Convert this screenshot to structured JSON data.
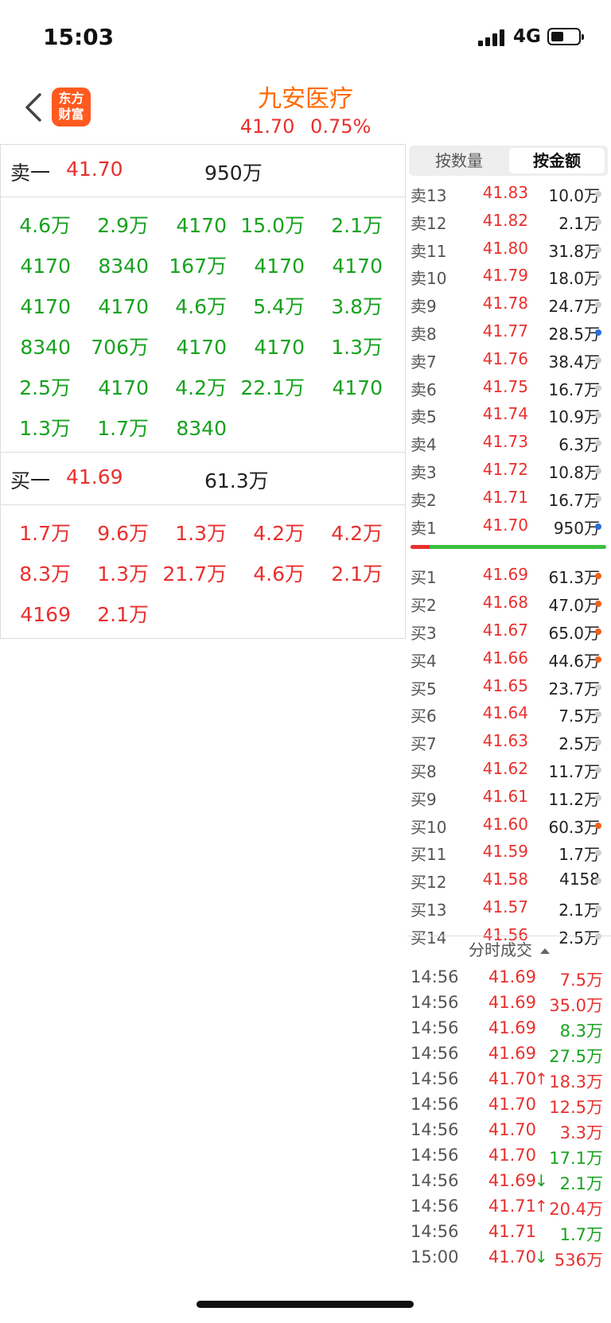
{
  "status": {
    "time": "15:03",
    "network": "4G"
  },
  "header": {
    "logo": "东方\n财富",
    "logo_top": "东方",
    "logo_bottom": "财富",
    "name": "九安医疗",
    "price": "41.70",
    "change": "0.75%"
  },
  "sell_summary": {
    "label": "卖一",
    "price": "41.70",
    "volume": "950万"
  },
  "sell_orders": [
    "4.6万",
    "2.9万",
    "4170",
    "15.0万",
    "2.1万",
    "4170",
    "8340",
    "167万",
    "4170",
    "4170",
    "4170",
    "4170",
    "4.6万",
    "5.4万",
    "3.8万",
    "8340",
    "706万",
    "4170",
    "4170",
    "1.3万",
    "2.5万",
    "4170",
    "4.2万",
    "22.1万",
    "4170",
    "1.3万",
    "1.7万",
    "8340"
  ],
  "buy_summary": {
    "label": "买一",
    "price": "41.69",
    "volume": "61.3万"
  },
  "buy_orders": [
    "1.7万",
    "9.6万",
    "1.3万",
    "4.2万",
    "4.2万",
    "8.3万",
    "1.3万",
    "21.7万",
    "4.6万",
    "2.1万",
    "4169",
    "2.1万"
  ],
  "tabs": {
    "by_quantity": "按数量",
    "by_amount": "按金额",
    "active": "by_amount"
  },
  "asks": [
    {
      "label": "卖13",
      "price": "41.83",
      "amount": "10.0万",
      "dot": "grey"
    },
    {
      "label": "卖12",
      "price": "41.82",
      "amount": "2.1万",
      "dot": "grey"
    },
    {
      "label": "卖11",
      "price": "41.80",
      "amount": "31.8万",
      "dot": "grey"
    },
    {
      "label": "卖10",
      "price": "41.79",
      "amount": "18.0万",
      "dot": "grey"
    },
    {
      "label": "卖9",
      "price": "41.78",
      "amount": "24.7万",
      "dot": "grey"
    },
    {
      "label": "卖8",
      "price": "41.77",
      "amount": "28.5万",
      "dot": "blue"
    },
    {
      "label": "卖7",
      "price": "41.76",
      "amount": "38.4万",
      "dot": "grey"
    },
    {
      "label": "卖6",
      "price": "41.75",
      "amount": "16.7万",
      "dot": "grey"
    },
    {
      "label": "卖5",
      "price": "41.74",
      "amount": "10.9万",
      "dot": "grey"
    },
    {
      "label": "卖4",
      "price": "41.73",
      "amount": "6.3万",
      "dot": "grey"
    },
    {
      "label": "卖3",
      "price": "41.72",
      "amount": "10.8万",
      "dot": "grey"
    },
    {
      "label": "卖2",
      "price": "41.71",
      "amount": "16.7万",
      "dot": "grey"
    },
    {
      "label": "卖1",
      "price": "41.70",
      "amount": "950万",
      "dot": "blue"
    }
  ],
  "bids": [
    {
      "label": "买1",
      "price": "41.69",
      "amount": "61.3万",
      "dot": "orange"
    },
    {
      "label": "买2",
      "price": "41.68",
      "amount": "47.0万",
      "dot": "orange"
    },
    {
      "label": "买3",
      "price": "41.67",
      "amount": "65.0万",
      "dot": "orange"
    },
    {
      "label": "买4",
      "price": "41.66",
      "amount": "44.6万",
      "dot": "orange"
    },
    {
      "label": "买5",
      "price": "41.65",
      "amount": "23.7万",
      "dot": "grey"
    },
    {
      "label": "买6",
      "price": "41.64",
      "amount": "7.5万",
      "dot": "grey"
    },
    {
      "label": "买7",
      "price": "41.63",
      "amount": "2.5万",
      "dot": "grey"
    },
    {
      "label": "买8",
      "price": "41.62",
      "amount": "11.7万",
      "dot": "grey"
    },
    {
      "label": "买9",
      "price": "41.61",
      "amount": "11.2万",
      "dot": "grey"
    },
    {
      "label": "买10",
      "price": "41.60",
      "amount": "60.3万",
      "dot": "orange"
    },
    {
      "label": "买11",
      "price": "41.59",
      "amount": "1.7万",
      "dot": "grey"
    },
    {
      "label": "买12",
      "price": "41.58",
      "amount": "4158",
      "dot": "grey"
    },
    {
      "label": "买13",
      "price": "41.57",
      "amount": "2.1万",
      "dot": "grey"
    },
    {
      "label": "买14",
      "price": "41.56",
      "amount": "2.5万",
      "dot": "grey"
    }
  ],
  "ticks_header": "分时成交",
  "ticks": [
    {
      "time": "14:56",
      "price": "41.69",
      "arrow": "",
      "amount": "7.5万",
      "side": "buy"
    },
    {
      "time": "14:56",
      "price": "41.69",
      "arrow": "",
      "amount": "35.0万",
      "side": "buy"
    },
    {
      "time": "14:56",
      "price": "41.69",
      "arrow": "",
      "amount": "8.3万",
      "side": "sell"
    },
    {
      "time": "14:56",
      "price": "41.69",
      "arrow": "",
      "amount": "27.5万",
      "side": "sell"
    },
    {
      "time": "14:56",
      "price": "41.70",
      "arrow": "↑",
      "amount": "18.3万",
      "side": "buy"
    },
    {
      "time": "14:56",
      "price": "41.70",
      "arrow": "",
      "amount": "12.5万",
      "side": "buy"
    },
    {
      "time": "14:56",
      "price": "41.70",
      "arrow": "",
      "amount": "3.3万",
      "side": "buy"
    },
    {
      "time": "14:56",
      "price": "41.70",
      "arrow": "",
      "amount": "17.1万",
      "side": "sell"
    },
    {
      "time": "14:56",
      "price": "41.69",
      "arrow": "↓",
      "amount": "2.1万",
      "side": "sell"
    },
    {
      "time": "14:56",
      "price": "41.71",
      "arrow": "↑",
      "amount": "20.4万",
      "side": "buy"
    },
    {
      "time": "14:56",
      "price": "41.71",
      "arrow": "",
      "amount": "1.7万",
      "side": "sell"
    },
    {
      "time": "15:00",
      "price": "41.70",
      "arrow": "↓",
      "amount": "536万",
      "side": "buy"
    }
  ],
  "colors": {
    "up": "#e8302e",
    "down": "#17a21f",
    "accent": "#ff6a00"
  }
}
